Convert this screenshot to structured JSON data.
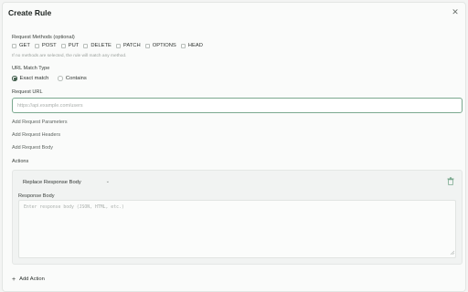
{
  "dialog": {
    "title": "Create Rule",
    "close_icon": "close-icon"
  },
  "methods": {
    "label": "Request Methods (optional)",
    "options": [
      "GET",
      "POST",
      "PUT",
      "DELETE",
      "PATCH",
      "OPTIONS",
      "HEAD"
    ],
    "checked": [
      false,
      false,
      false,
      false,
      false,
      false,
      false
    ],
    "hint": "If no methods are selected, the rule will match any method."
  },
  "match": {
    "label": "URL Match Type",
    "options": [
      "Exact match",
      "Contains"
    ],
    "selected": "Exact match"
  },
  "url": {
    "label": "Request URL",
    "value": "",
    "placeholder": "https://api.example.com/users"
  },
  "links": {
    "add_params": "Add Request Parameters",
    "add_headers": "Add Request Headers",
    "add_body": "Add Request Body"
  },
  "actions": {
    "label": "Actions",
    "items": [
      {
        "type": "Replace Response Body",
        "body_label": "Response Body",
        "body_value": "",
        "body_placeholder": "Enter response body (JSON, HTML, etc.)"
      }
    ],
    "add_label": "Add Action"
  },
  "colors": {
    "accent_border": "#7ba98f",
    "radio_selected": "#3d5a48",
    "card_bg": "#f1f3f2",
    "trash_icon": "#7ba98f"
  }
}
